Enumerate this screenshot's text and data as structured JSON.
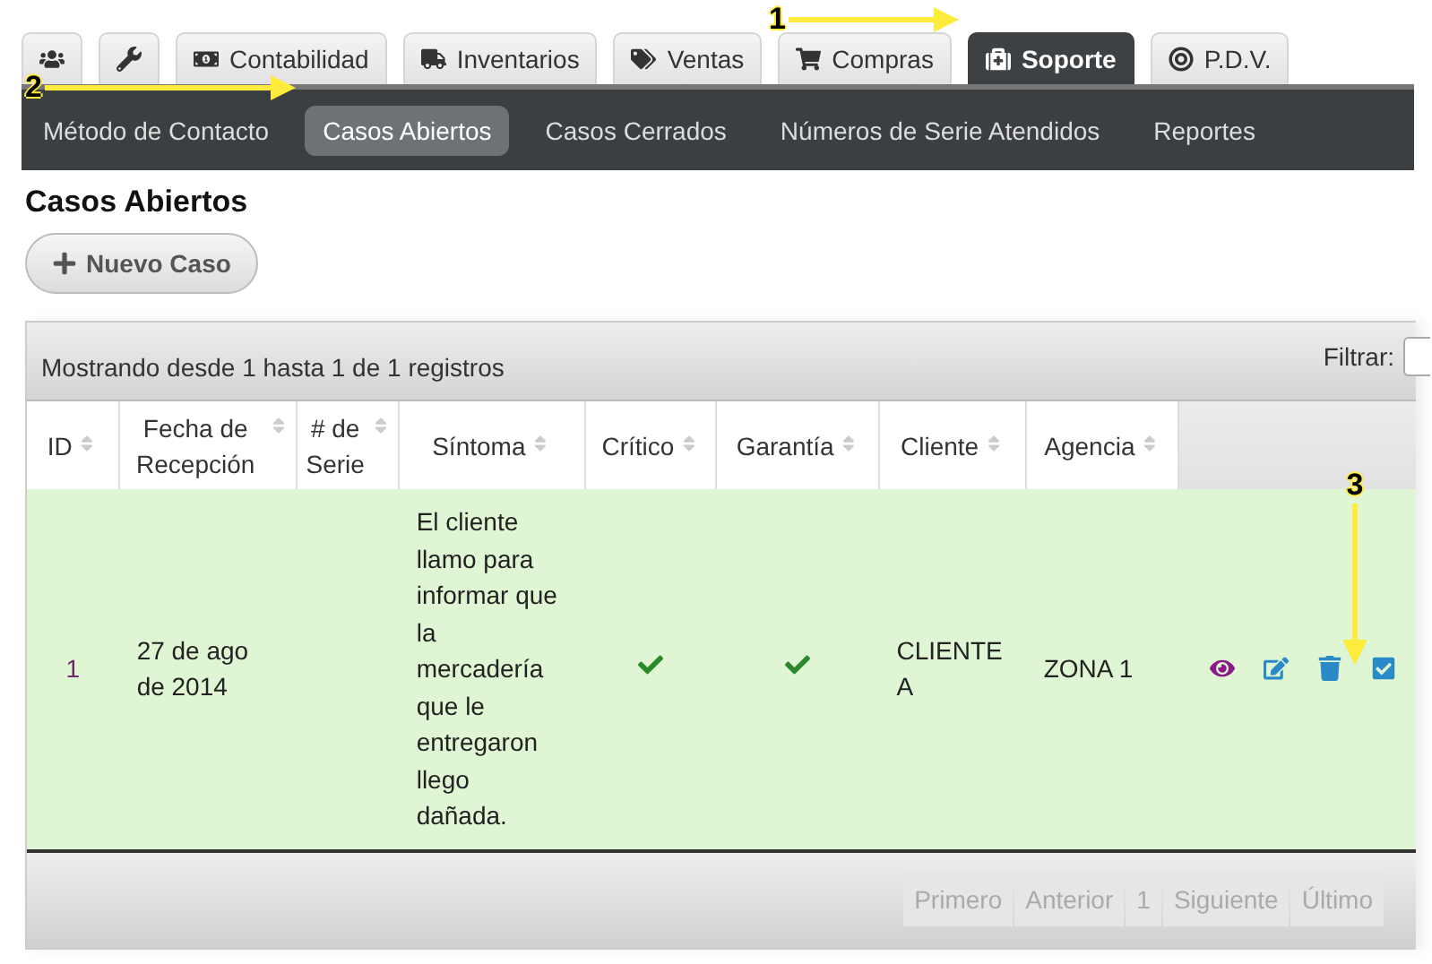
{
  "tabs": [
    {
      "kind": "users",
      "selected": false
    },
    {
      "kind": "wrench",
      "selected": false
    },
    {
      "kind": "money",
      "label": "Contabilidad",
      "selected": false
    },
    {
      "kind": "truck",
      "label": "Inventarios",
      "selected": false
    },
    {
      "kind": "tags",
      "label": "Ventas",
      "selected": false
    },
    {
      "kind": "cart",
      "label": "Compras",
      "selected": false
    },
    {
      "kind": "medkit",
      "label": "Soporte",
      "selected": true
    },
    {
      "kind": "target",
      "label": "P.D.V.",
      "selected": false
    }
  ],
  "subnav": [
    {
      "label": "Método de Contacto",
      "selected": false
    },
    {
      "label": "Casos Abiertos",
      "selected": true
    },
    {
      "label": "Casos Cerrados",
      "selected": false
    },
    {
      "label": "Números de Serie Atendidos",
      "selected": false
    },
    {
      "label": "Reportes",
      "selected": false
    }
  ],
  "page_title": "Casos Abiertos",
  "new_button": "Nuevo Caso",
  "table": {
    "info": "Mostrando desde 1 hasta 1 de 1 registros",
    "filter_label": "Filtrar:",
    "columns": [
      "ID",
      "Fecha de Recepción",
      "# de Serie",
      "Síntoma",
      "Crítico",
      "Garantía",
      "Cliente",
      "Agencia"
    ],
    "rows": [
      {
        "id": "1",
        "fecha": "27 de ago de 2014",
        "serie": "",
        "sintoma": "El cliente llamo para informar que la mercadería que le entregaron llego dañada.",
        "critico": true,
        "garantia": true,
        "cliente": "CLIENTE A",
        "agencia": "ZONA 1"
      }
    ],
    "pagination": [
      {
        "label": "Primero",
        "disabled": true
      },
      {
        "label": "Anterior",
        "disabled": true
      },
      {
        "label": "1",
        "disabled": true
      },
      {
        "label": "Siguiente",
        "disabled": true
      },
      {
        "label": "Último",
        "disabled": true
      }
    ]
  },
  "annotations": [
    {
      "label": "1",
      "kind": "arrow-right"
    },
    {
      "label": "2",
      "kind": "arrow-right"
    },
    {
      "label": "3",
      "kind": "arrow-down"
    }
  ]
}
